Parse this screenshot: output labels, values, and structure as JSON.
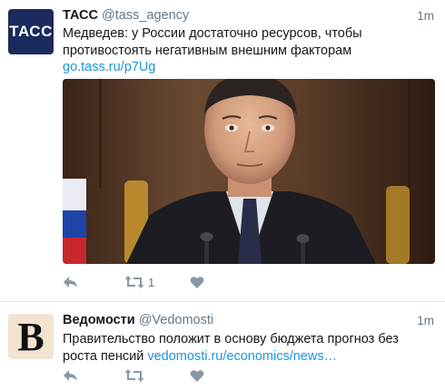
{
  "tweets": [
    {
      "avatar_text": "ТАСС",
      "name": "ТАСС",
      "handle": "@tass_agency",
      "time": "1m",
      "text": "Медведев: у России достаточно ресурсов, чтобы противостоять негативным внешним факторам",
      "link": "go.tass.ru/p7Ug",
      "retweet_count": "1"
    },
    {
      "avatar_text": "B",
      "name": "Ведомости",
      "handle": "@Vedomosti",
      "time": "1m",
      "text": "Правительство положит в основу бюджета прогноз без роста пенсий",
      "link": "vedomosti.ru/economics/news…"
    }
  ],
  "icons": {
    "reply": "reply-icon",
    "retweet": "retweet-icon",
    "like": "heart-icon"
  },
  "colors": {
    "link": "#1b95e0",
    "secondary_text": "#657786",
    "icon": "#8899a6",
    "tass_brand": "#1b2a5c"
  }
}
